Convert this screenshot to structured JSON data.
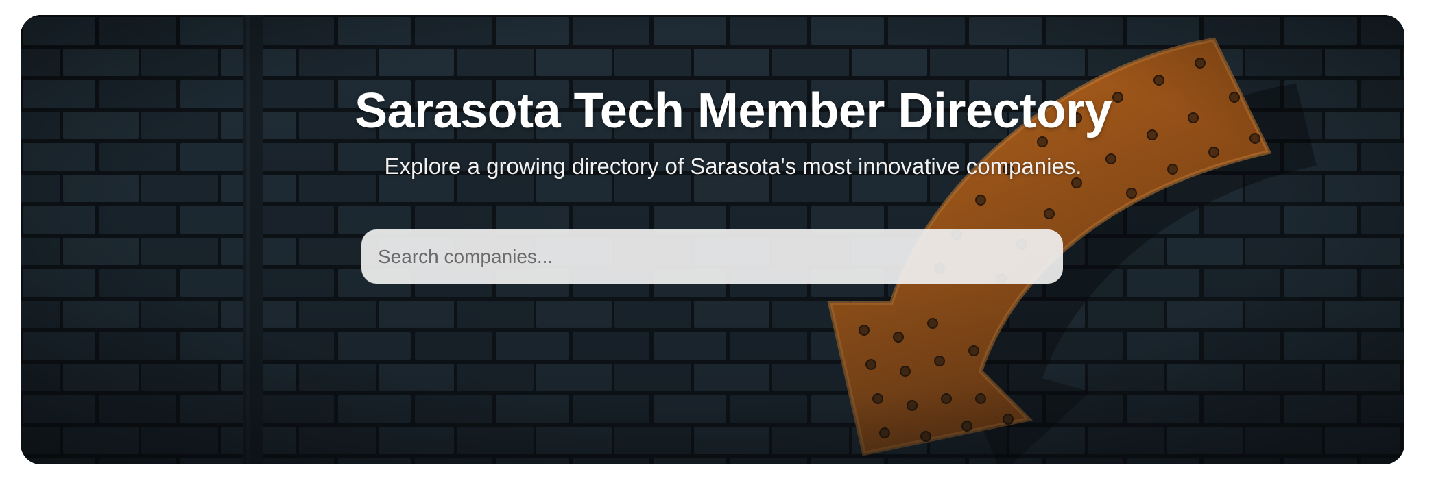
{
  "hero": {
    "title": "Sarasota Tech Member Directory",
    "subtitle": "Explore a growing directory of Sarasota's most innovative companies.",
    "background": "brick-wall-with-marquee-arrow-image"
  },
  "search": {
    "placeholder": "Search companies...",
    "value": ""
  },
  "colors": {
    "title_text": "#ffffff",
    "subtitle_text": "#f1f1f1",
    "search_background": "#f0f0f0",
    "placeholder_text": "#6a6a6a",
    "arrow_accent": "#c7641a"
  }
}
